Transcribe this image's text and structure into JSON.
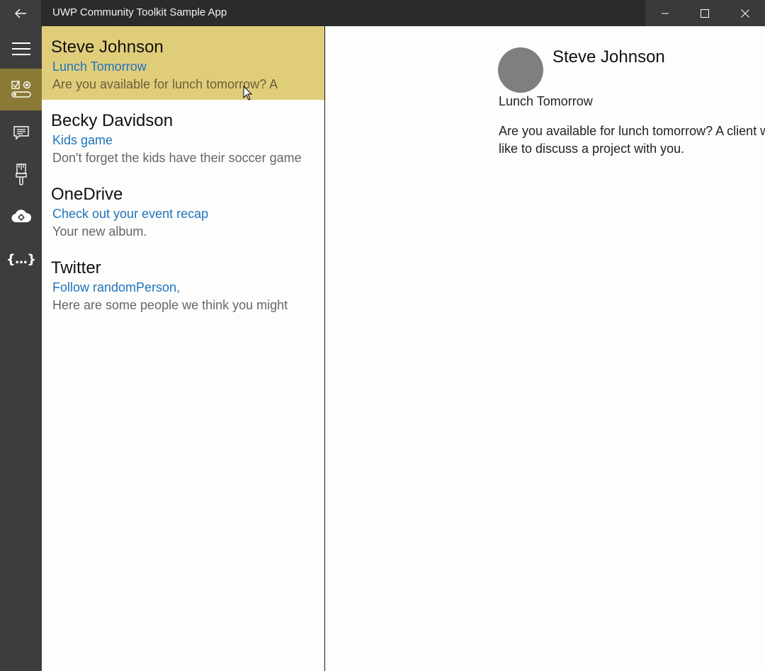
{
  "window": {
    "title": "UWP Community Toolkit Sample App",
    "back_icon": "back-arrow-icon",
    "captions": [
      "minimize-icon",
      "maximize-icon",
      "close-icon"
    ]
  },
  "nav_rail": {
    "items": [
      {
        "icon": "hamburger-menu-icon"
      },
      {
        "icon": "controls-icon",
        "active": true
      },
      {
        "icon": "notifications-icon"
      },
      {
        "icon": "brush-icon"
      },
      {
        "icon": "cloud-services-icon"
      },
      {
        "icon": "braces-icon",
        "glyph": "{...}"
      }
    ],
    "accent_color": "#8b7a35"
  },
  "messages": [
    {
      "from": "Steve Johnson",
      "subject": "Lunch Tomorrow",
      "preview": "Are you available for lunch tomorrow? A",
      "selected": true
    },
    {
      "from": "Becky Davidson",
      "subject": "Kids game",
      "preview": "Don't forget the kids have their soccer game",
      "selected": false
    },
    {
      "from": "OneDrive",
      "subject": "Check out your event recap",
      "preview": "Your new album.",
      "selected": false
    },
    {
      "from": "Twitter",
      "subject": "Follow randomPerson,",
      "preview": "Here are some people we think you might",
      "selected": false
    }
  ],
  "detail": {
    "from": "Steve Johnson",
    "subject": "Lunch Tomorrow",
    "body": "Are you available for lunch tomorrow? A client would like to discuss a project with you."
  },
  "colors": {
    "selected_bg": "#e0cd7a",
    "subject_link": "#1e73be",
    "titlebar": "#2b2b2b"
  }
}
